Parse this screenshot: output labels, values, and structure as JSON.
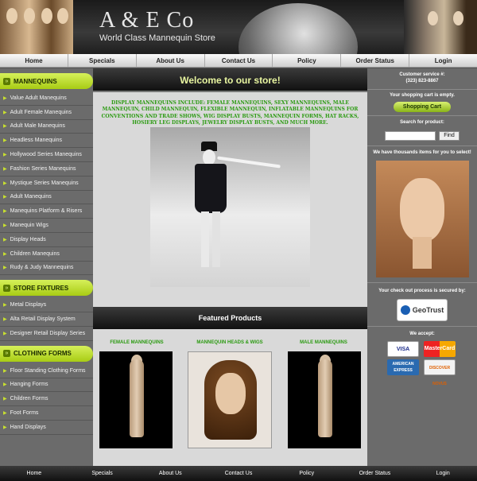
{
  "header": {
    "brand": "A & E Co",
    "tagline": "World Class Mannequin Store"
  },
  "topnav": [
    "Home",
    "Specials",
    "About Us",
    "Contact Us",
    "Policy",
    "Order Status",
    "Login"
  ],
  "sidebar": {
    "categories": [
      {
        "title": "MANNEQUINS",
        "items": [
          "Value Adult Manequins",
          "Adult Female Manequins",
          "Adult Male Manequins",
          "Headless Manequins",
          "Hollywood Series Manequins",
          "Fashion Series Manequins",
          "Mystique Series Manequins",
          "Adult Manequins",
          "Manequins Platform & Risers",
          "Manequin Wigs",
          "Display Heads",
          "Children Manequins",
          "Rudy & Judy Mannequins"
        ]
      },
      {
        "title": "STORE FIXTURES",
        "items": [
          "Metal Displays",
          "Alta Retail Display System",
          "Designer Retail Display Series"
        ]
      },
      {
        "title": "CLOTHING FORMS",
        "items": [
          "Floor Standing Clothing Forms",
          "Hanging Forms",
          "Children Forms",
          "Foot Forms",
          "Hand Displays"
        ]
      }
    ]
  },
  "main": {
    "welcome": "Welcome to our store!",
    "intro": "DISPLAY MANNEQUINS INCLUDE: FEMALE MANNEQUINS, SEXY MANNEQUINS, MALE MANNEQUIN, CHILD MANNEQUIN, FLEXIBLE MANNEQUIN, INFLATABLE MANNEQUINS FOR CONVENTIONS AND TRADE SHOWS, WIG DISPLAY BUSTS, MANNEQUIN FORMS, HAT RACKS, HOSIERY LEG DISPLAYS, JEWELRY DISPLAY BUSTS, AND MUCH MORE.",
    "featured_title": "Featured Products",
    "products": [
      {
        "title": "FEMALE MANNEQUINS"
      },
      {
        "title": "MANNEQUIN HEADS & WIGS"
      },
      {
        "title": "MALE MANNEQUINS"
      }
    ]
  },
  "right": {
    "customer_service": "Customer service #:",
    "phone": "(323) 823-8867",
    "cart_status": "Your shopping cart is empty.",
    "cart_button": "Shopping Cart",
    "search_label": "Search for product:",
    "search_value": "",
    "search_button": "Find",
    "promo_text": "We have thousands items for you to select!",
    "secure_text": "Your check out process is secured by:",
    "geotrust_label": "GeoTrust",
    "accept_text": "We accept:",
    "cards": [
      "VISA",
      "MasterCard",
      "AMERICAN EXPRESS",
      "DISCOVER NOVUS"
    ]
  },
  "footer": [
    "Home",
    "Specials",
    "About Us",
    "Contact Us",
    "Policy",
    "Order Status",
    "Login"
  ]
}
